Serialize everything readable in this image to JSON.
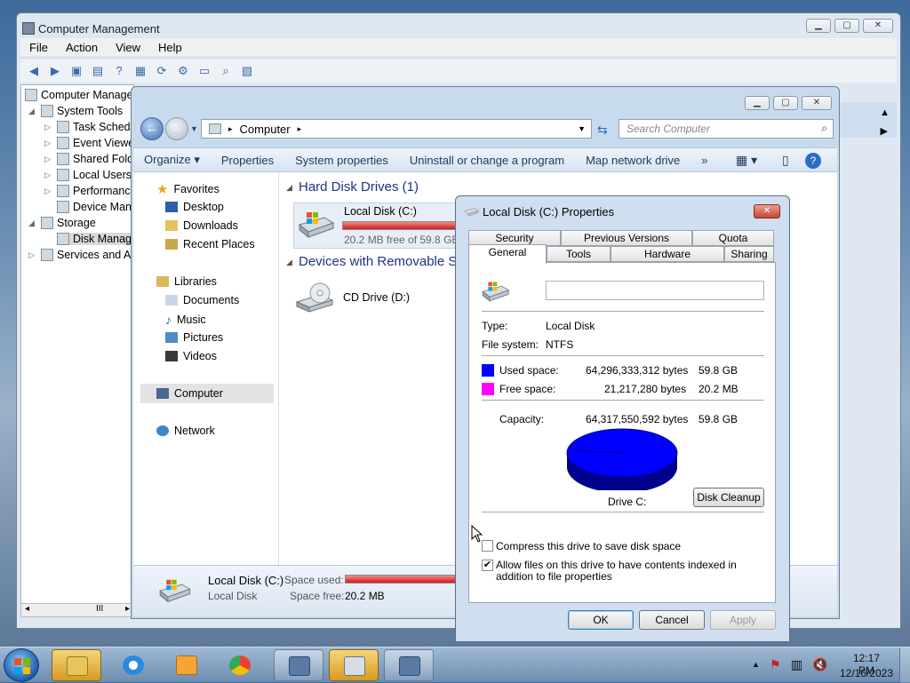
{
  "cm": {
    "title": "Computer Management",
    "menu": [
      "File",
      "Action",
      "View",
      "Help"
    ],
    "tree": [
      "Computer Manage",
      "System Tools",
      "Task Schedu",
      "Event Viewe",
      "Shared Fold",
      "Local Users",
      "Performanc",
      "Device Man",
      "Storage",
      "Disk Manag",
      "Services and Ap"
    ],
    "scroll_mark": "III"
  },
  "explorer": {
    "address": [
      "Computer"
    ],
    "search_placeholder": "Search Computer",
    "commands": [
      "Organize ▾",
      "Properties",
      "System properties",
      "Uninstall or change a program",
      "Map network drive",
      "»"
    ],
    "nav": {
      "favorites": "Favorites",
      "desktop": "Desktop",
      "downloads": "Downloads",
      "recent": "Recent Places",
      "libraries": "Libraries",
      "documents": "Documents",
      "music": "Music",
      "pictures": "Pictures",
      "videos": "Videos",
      "computer": "Computer",
      "network": "Network"
    },
    "groups": {
      "hdd": "Hard Disk Drives (1)",
      "removable": "Devices with Removable St"
    },
    "drive_c": {
      "name": "Local Disk (C:)",
      "free_text": "20.2 MB free of 59.8 GB",
      "used_fraction": 0.9997
    },
    "drive_d": {
      "name": "CD Drive (D:)"
    },
    "details": {
      "name": "Local Disk (C:)",
      "type": "Local Disk",
      "space_used_label": "Space used:",
      "space_free_label": "Space free:",
      "space_free_value": "20.2 MB"
    }
  },
  "dialog": {
    "title": "Local Disk (C:) Properties",
    "tabs_back": [
      "Security",
      "Previous Versions",
      "Quota"
    ],
    "tabs_front": [
      "General",
      "Tools",
      "Hardware",
      "Sharing"
    ],
    "type_label": "Type:",
    "type_value": "Local Disk",
    "fs_label": "File system:",
    "fs_value": "NTFS",
    "used_label": "Used space:",
    "used_bytes": "64,296,333,312 bytes",
    "used_gb": "59.8 GB",
    "free_label": "Free space:",
    "free_bytes": "21,217,280 bytes",
    "free_gb": "20.2 MB",
    "cap_label": "Capacity:",
    "cap_bytes": "64,317,550,592 bytes",
    "cap_gb": "59.8 GB",
    "drive_label": "Drive C:",
    "cleanup": "Disk Cleanup",
    "compress": "Compress this drive to save disk space",
    "index": "Allow files on this drive to have contents indexed in addition to file properties",
    "index_checked": true,
    "compress_checked": false,
    "ok": "OK",
    "cancel": "Cancel",
    "apply": "Apply",
    "used_color": "#0000ff",
    "free_color": "#ff00ff"
  },
  "taskbar": {
    "time": "12:17 PM",
    "date": "12/16/2023"
  }
}
